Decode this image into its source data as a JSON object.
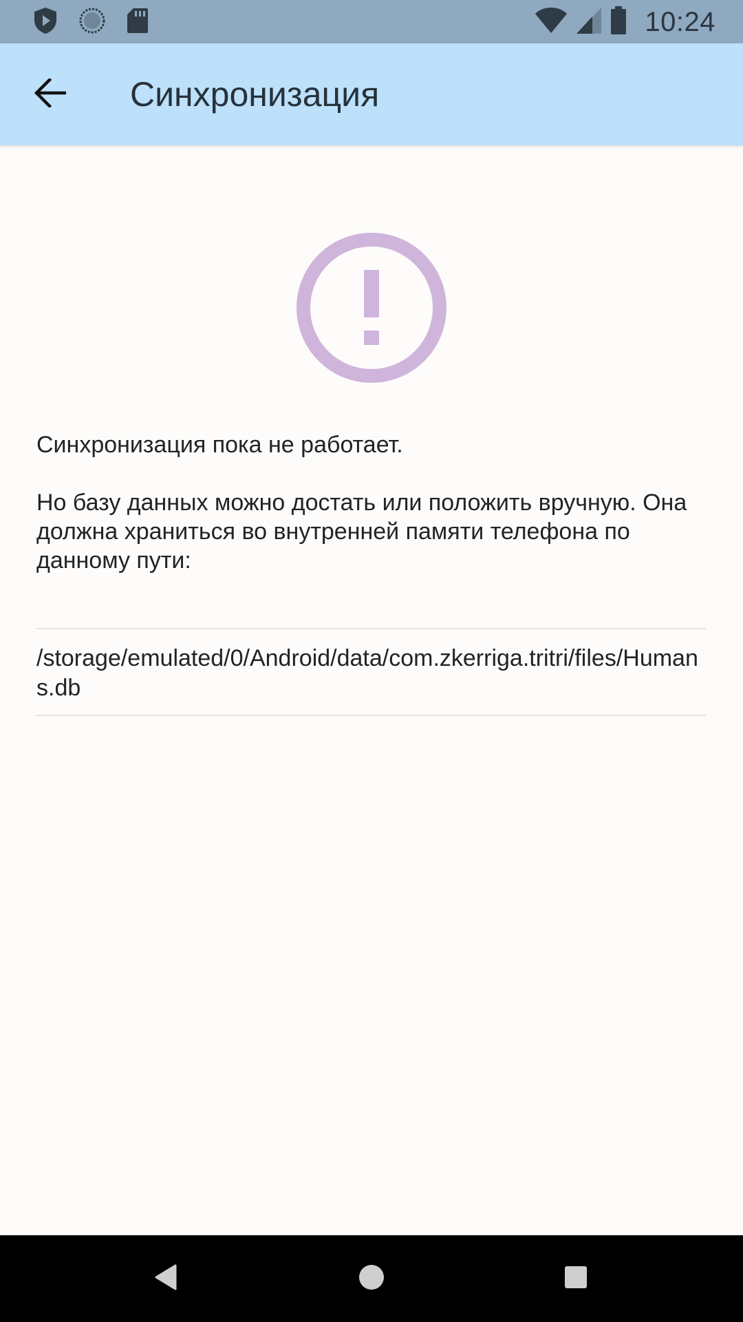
{
  "status_bar": {
    "time": "10:24",
    "left_icons": [
      "play-protect-icon",
      "sync-circle-icon",
      "sd-card-icon"
    ],
    "right_icons": [
      "wifi-icon",
      "cell-signal-icon",
      "battery-icon"
    ]
  },
  "app_bar": {
    "title": "Синхронизация",
    "back_icon": "arrow-back-icon"
  },
  "warning": {
    "icon": "exclamation-circle-icon",
    "color": "#cfb5dc"
  },
  "message": {
    "line1": "Синхронизация пока не работает.",
    "line2": "Но базу данных можно достать или положить вручную. Она должна храниться во внутренней памяти телефона по данному пути:"
  },
  "path": {
    "value": "/storage/emulated/0/Android/data/com.zkerriga.tritri/files/Humans.db"
  },
  "nav_bar": {
    "buttons": [
      "back-triangle-icon",
      "home-circle-icon",
      "recents-square-icon"
    ]
  },
  "colors": {
    "status_bar": "#8fa9c0",
    "app_bar": "#bde0fb",
    "background": "#fdfcfb",
    "nav_bar": "#000000"
  }
}
